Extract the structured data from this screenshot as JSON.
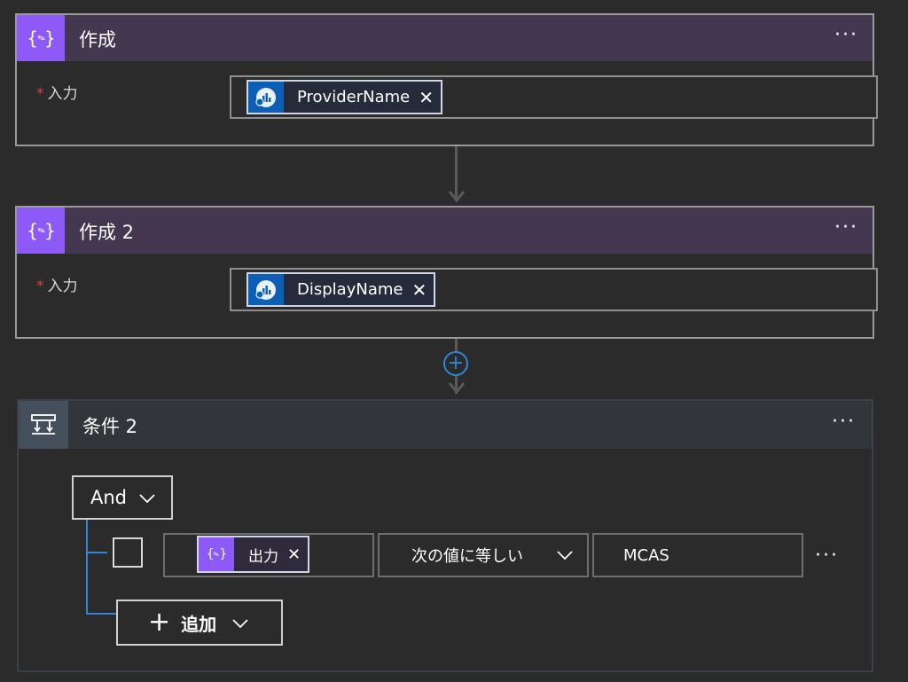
{
  "compose1": {
    "title": "作成",
    "icon": "compose-icon",
    "more": "···",
    "required_mark": "*",
    "field_label": "入力",
    "token_label": "ProviderName",
    "token_remove": "✕",
    "token_icon": "dynamic-content-icon"
  },
  "compose2": {
    "title": "作成 2",
    "icon": "compose-icon",
    "more": "···",
    "required_mark": "*",
    "field_label": "入力",
    "token_label": "DisplayName",
    "token_remove": "✕",
    "token_icon": "dynamic-content-icon"
  },
  "add_step": {
    "symbol": "+"
  },
  "condition": {
    "title": "条件 2",
    "icon": "condition-icon",
    "more": "···",
    "group_operator": "And",
    "row": {
      "left_token": "出力",
      "left_token_remove": "✕",
      "operator": "次の値に等しい",
      "value": "MCAS",
      "more": "···"
    },
    "add_label": "追加",
    "add_symbol": "+"
  },
  "colors": {
    "compose_accent": "#8e5af7",
    "compose_header": "#43384f",
    "dynamic_icon": "#0d5fb5",
    "link_blue": "#2f86d6",
    "required": "#e03e3e"
  }
}
